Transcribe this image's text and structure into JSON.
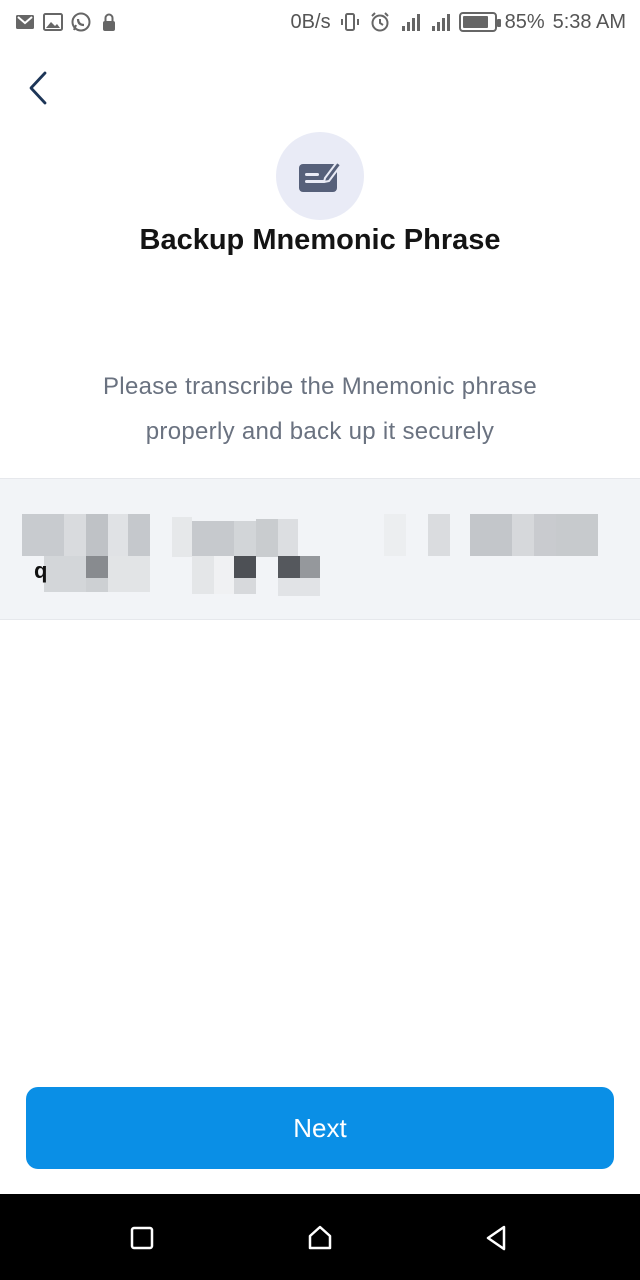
{
  "status_bar": {
    "network_speed": "0B/s",
    "battery_percent": "85%",
    "battery_level": 0.85,
    "time": "5:38 AM",
    "left_icons": [
      "gmail-icon",
      "gallery-icon",
      "whatsapp-icon",
      "lock-icon"
    ],
    "right_icons": [
      "vibrate-icon",
      "alarm-icon",
      "signal-icon",
      "signal-icon",
      "battery-icon"
    ]
  },
  "header": {
    "back_icon": "chevron-left-icon",
    "hero_icon": "edit-note-icon",
    "title": "Backup Mnemonic Phrase",
    "subtitle": "Please transcribe the Mnemonic phrase properly and back up it securely"
  },
  "mnemonic": {
    "visible_glyph": "q"
  },
  "actions": {
    "next_label": "Next"
  },
  "colors": {
    "accent": "#0a8fe6",
    "hero_bg": "#e9ebf6",
    "subtitle": "#6a7280",
    "box_bg": "#f2f4f7"
  },
  "nav_bar": {
    "icons": [
      "square-recents-icon",
      "home-icon",
      "back-triangle-icon"
    ]
  }
}
